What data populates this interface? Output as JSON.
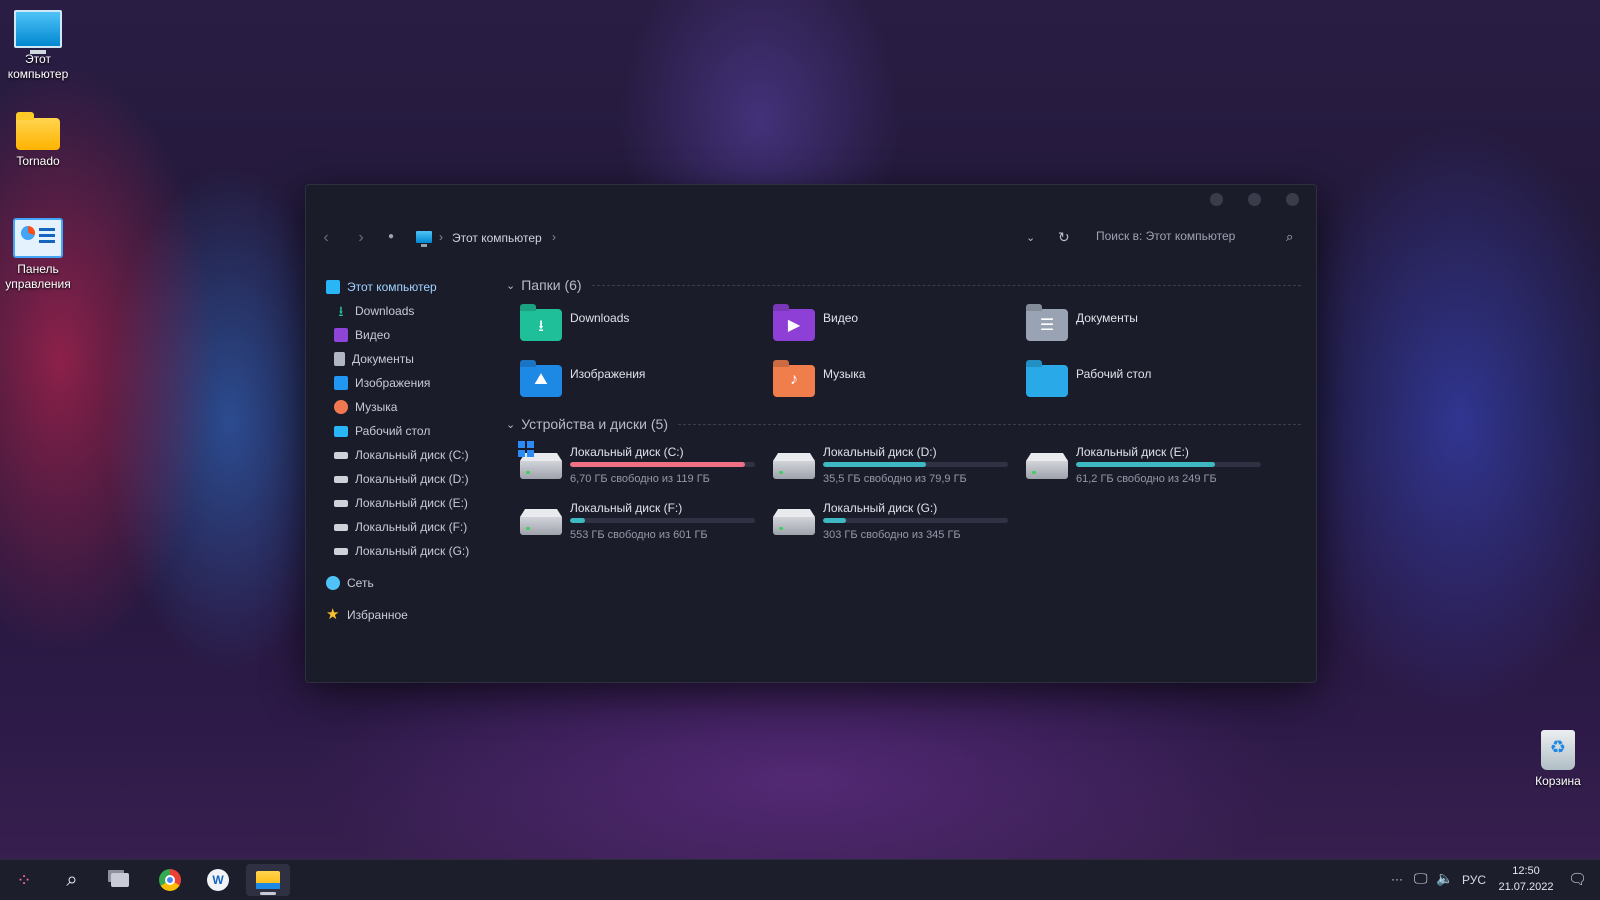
{
  "desktop": {
    "icons": [
      {
        "label_line1": "Этот",
        "label_line2": "компьютер"
      },
      {
        "label_line1": "Tornado",
        "label_line2": ""
      },
      {
        "label_line1": "Панель",
        "label_line2": "управления"
      },
      {
        "label_line1": "Корзина",
        "label_line2": ""
      }
    ]
  },
  "window": {
    "breadcrumb": {
      "location": "Этот компьютер",
      "separator": "›"
    },
    "search": {
      "placeholder": "Поиск в: Этот компьютер"
    },
    "icons": {
      "back": "back-arrow-icon",
      "forward": "forward-arrow-icon",
      "history": "dot-icon",
      "dropdown": "chevron-down-icon",
      "refresh": "refresh-icon",
      "search": "magnifier-icon"
    }
  },
  "sidebar": {
    "items": [
      {
        "label": "Этот компьютер",
        "icon": "monitor-icon",
        "color": "#29b6f6"
      },
      {
        "label": "Downloads",
        "icon": "download-icon",
        "color": "#26c6a6"
      },
      {
        "label": "Видео",
        "icon": "video-icon",
        "color": "#8e44d6"
      },
      {
        "label": "Документы",
        "icon": "document-icon",
        "color": "#b0b6c4"
      },
      {
        "label": "Изображения",
        "icon": "picture-icon",
        "color": "#2196f3"
      },
      {
        "label": "Музыка",
        "icon": "music-icon",
        "color": "#f07850"
      },
      {
        "label": "Рабочий стол",
        "icon": "desktop-icon",
        "color": "#29b6f6"
      },
      {
        "label": "Локальный диск (C:)",
        "icon": "drive-icon",
        "color": "#cfd2d8"
      },
      {
        "label": "Локальный диск (D:)",
        "icon": "drive-icon",
        "color": "#cfd2d8"
      },
      {
        "label": "Локальный диск (E:)",
        "icon": "drive-icon",
        "color": "#cfd2d8"
      },
      {
        "label": "Локальный диск (F:)",
        "icon": "drive-icon",
        "color": "#cfd2d8"
      },
      {
        "label": "Локальный диск (G:)",
        "icon": "drive-icon",
        "color": "#cfd2d8"
      },
      {
        "label": "Сеть",
        "icon": "network-icon",
        "color": "#4fc3f7"
      },
      {
        "label": "Избранное",
        "icon": "star-icon",
        "color": "#fbc02d"
      }
    ]
  },
  "folders": {
    "title": "Папки (6)",
    "items": [
      {
        "label": "Downloads",
        "icon": "downloads-folder-icon",
        "color": "#1fbf9a",
        "glyph": "⭳"
      },
      {
        "label": "Видео",
        "icon": "video-folder-icon",
        "color": "#8e3fd6",
        "glyph": "▶"
      },
      {
        "label": "Документы",
        "icon": "documents-folder-icon",
        "color": "#9aa3b4",
        "glyph": "☰"
      },
      {
        "label": "Изображения",
        "icon": "pictures-folder-icon",
        "color": "#1e88e5",
        "glyph": "⛰"
      },
      {
        "label": "Музыка",
        "icon": "music-folder-icon",
        "color": "#f07d4c",
        "glyph": "♪"
      },
      {
        "label": "Рабочий стол",
        "icon": "desktop-folder-icon",
        "color": "#29a9e8",
        "glyph": ""
      }
    ]
  },
  "drives": {
    "title": "Устройства и диски (5)",
    "items": [
      {
        "name": "Локальный диск (C:)",
        "free": "6,70 ГБ свободно из 119 ГБ",
        "used_fraction": 0.944,
        "bar_color": "#ef6f84",
        "system": true
      },
      {
        "name": "Локальный диск (D:)",
        "free": "35,5 ГБ свободно из 79,9 ГБ",
        "used_fraction": 0.556,
        "bar_color": "#3fb9c1",
        "system": false
      },
      {
        "name": "Локальный диск (E:)",
        "free": "61,2 ГБ свободно из 249 ГБ",
        "used_fraction": 0.754,
        "bar_color": "#3fb9c1",
        "system": false
      },
      {
        "name": "Локальный диск (F:)",
        "free": "553 ГБ свободно из 601 ГБ",
        "used_fraction": 0.08,
        "bar_color": "#3fb9c1",
        "system": false
      },
      {
        "name": "Локальный диск (G:)",
        "free": "303 ГБ свободно из 345 ГБ",
        "used_fraction": 0.122,
        "bar_color": "#3fb9c1",
        "system": false
      }
    ]
  },
  "taskbar": {
    "apps": [
      "start-icon",
      "search-icon",
      "task-view-icon",
      "chrome-icon",
      "app-icon",
      "file-explorer-icon"
    ],
    "tray": {
      "overflow": "···",
      "language": "РУС"
    },
    "clock": {
      "time": "12:50",
      "date": "21.07.2022"
    }
  }
}
